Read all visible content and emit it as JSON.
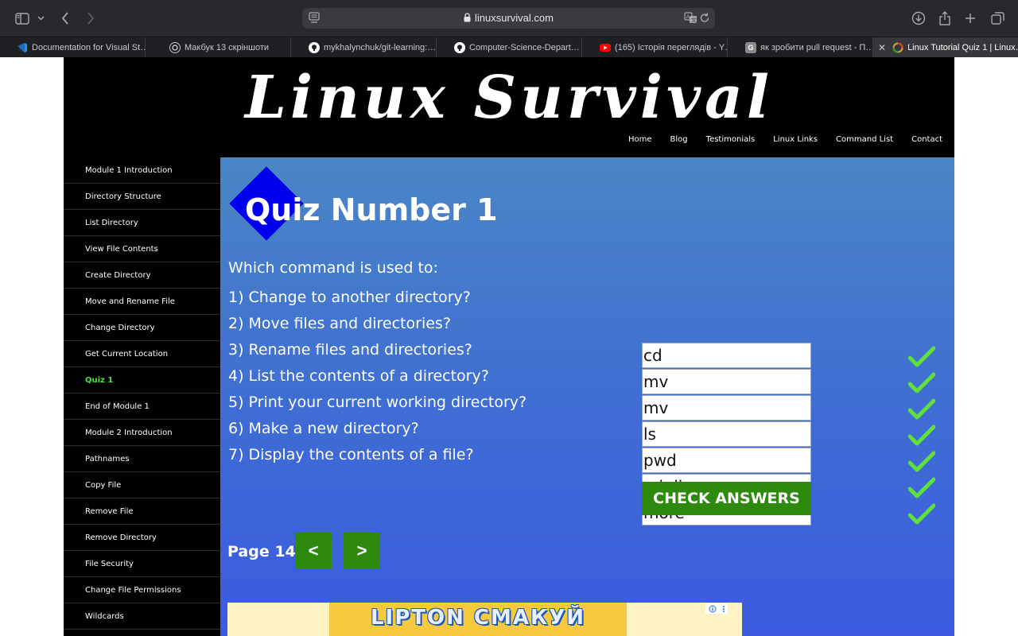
{
  "browser": {
    "url": "linuxsurvival.com",
    "tabs": [
      {
        "label": "Documentation for Visual St…",
        "icon": "vscode-icon",
        "color": "#2b7fd3"
      },
      {
        "label": "Макбук 13 скріншоти",
        "icon": "chatgpt-icon",
        "color": "#ffffff"
      },
      {
        "label": "mykhalynchuk/git-learning:…",
        "icon": "github-icon",
        "color": "#ffffff"
      },
      {
        "label": "Computer-Science-Depart…",
        "icon": "github-icon",
        "color": "#ffffff"
      },
      {
        "label": "(165) Історія переглядів - Y…",
        "icon": "youtube-icon",
        "color": "#ff0000"
      },
      {
        "label": "як зробити pull request - П…",
        "icon": "g-icon",
        "color": "#8a8a8a"
      },
      {
        "label": "Linux Tutorial Quiz 1 | Linux…",
        "icon": "linuxsurvival-icon",
        "color": "#e0a030"
      }
    ]
  },
  "site": {
    "logo": "Linux Survival",
    "nav": [
      "Home",
      "Blog",
      "Testimonials",
      "Linux Links",
      "Command List",
      "Contact"
    ],
    "sidebar": [
      {
        "label": "Module 1 Introduction",
        "active": false
      },
      {
        "label": "Directory Structure",
        "active": false
      },
      {
        "label": "List Directory",
        "active": false
      },
      {
        "label": "View File Contents",
        "active": false
      },
      {
        "label": "Create Directory",
        "active": false
      },
      {
        "label": "Move and Rename File",
        "active": false
      },
      {
        "label": "Change Directory",
        "active": false
      },
      {
        "label": "Get Current Location",
        "active": false
      },
      {
        "label": "Quiz 1",
        "active": true
      },
      {
        "label": "End of Module 1",
        "active": false
      },
      {
        "label": "Module 2 Introduction",
        "active": false
      },
      {
        "label": "Pathnames",
        "active": false
      },
      {
        "label": "Copy File",
        "active": false
      },
      {
        "label": "Remove File",
        "active": false
      },
      {
        "label": "Remove Directory",
        "active": false
      },
      {
        "label": "File Security",
        "active": false
      },
      {
        "label": "Change File Permissions",
        "active": false
      },
      {
        "label": "Wildcards",
        "active": false
      }
    ]
  },
  "quiz": {
    "title": "Quiz Number 1",
    "prompt": "Which command is used to:",
    "questions": [
      {
        "text": "1) Change to another directory?",
        "answer": "cd",
        "correct": true
      },
      {
        "text": "2) Move files and directories?",
        "answer": "mv",
        "correct": true
      },
      {
        "text": "3) Rename files and directories?",
        "answer": "mv",
        "correct": true
      },
      {
        "text": "4) List the contents of a directory?",
        "answer": "ls",
        "correct": true
      },
      {
        "text": "5) Print your current working directory?",
        "answer": "pwd",
        "correct": true
      },
      {
        "text": "6) Make a new directory?",
        "answer": "mkdir",
        "correct": true
      },
      {
        "text": "7) Display the contents of a file?",
        "answer": "more",
        "correct": true
      }
    ],
    "check_label": "CHECK ANSWERS",
    "page_label": "Page 14",
    "prev_label": "<",
    "next_label": ">",
    "accent": "#2d8a0c",
    "check_color": "#5fe03b"
  },
  "ad": {
    "text": "LIPTON СМАКУЙ"
  }
}
